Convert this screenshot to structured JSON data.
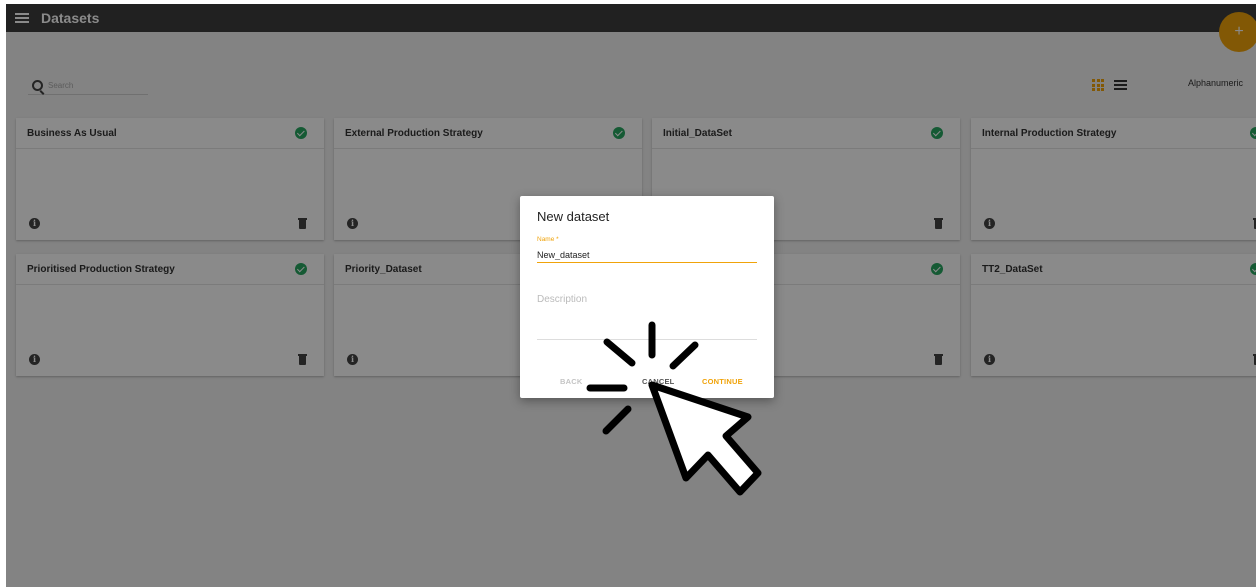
{
  "topbar": {
    "title": "Datasets"
  },
  "fab": {
    "label": "+"
  },
  "search": {
    "placeholder": "Search"
  },
  "toolbar": {
    "sort_label": "Alphanumeric"
  },
  "cards": [
    {
      "name": "Business As Usual"
    },
    {
      "name": "External Production Strategy"
    },
    {
      "name": "Initial_DataSet"
    },
    {
      "name": "Internal Production Strategy"
    },
    {
      "name": "Prioritised Production Strategy"
    },
    {
      "name": "Priority_Dataset"
    },
    {
      "name": ""
    },
    {
      "name": "TT2_DataSet"
    }
  ],
  "dialog": {
    "title": "New dataset",
    "name_label": "Name *",
    "name_value": "New_dataset",
    "description_placeholder": "Description",
    "back_label": "BACK",
    "cancel_label": "CANCEL",
    "continue_label": "CONTINUE"
  },
  "colors": {
    "accent": "#f0a30a",
    "status_ok": "#27a660",
    "topbar": "#3d3d3d"
  }
}
